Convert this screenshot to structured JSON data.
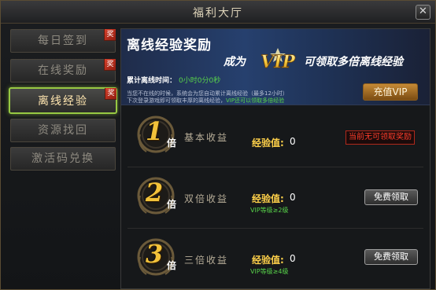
{
  "window": {
    "title": "福利大厅",
    "close_glyph": "✕"
  },
  "sidebar": {
    "items": [
      {
        "label": "每日签到",
        "badge": "奖",
        "active": false
      },
      {
        "label": "在线奖励",
        "badge": "奖",
        "active": false
      },
      {
        "label": "离线经验",
        "badge": "奖",
        "active": true
      },
      {
        "label": "资源找回",
        "badge": "",
        "active": false
      },
      {
        "label": "激活码兑换",
        "badge": "",
        "active": false
      }
    ]
  },
  "banner": {
    "title": "离线经验奖励",
    "vip_prefix": "成为",
    "vip_logo": "VIP",
    "vip_suffix": "可领取多倍离线经验",
    "offline_label": "累计离线时间：",
    "offline_value": "0小时0分0秒",
    "note1_a": "当您不在线的时候，系统会为您自动累计离线经验（最多12小时）",
    "note2_a": "下次登录游戏即可领取丰厚的离线经验，",
    "note2_b": "VIP还可以领取多倍经验",
    "recharge_label": "充值VIP"
  },
  "rewards": [
    {
      "multiplier": "1",
      "unit": "倍",
      "name": "基本收益",
      "exp_label": "经验值:",
      "exp_value": "0",
      "requirement": "",
      "status": "当前无可领取奖励",
      "button": ""
    },
    {
      "multiplier": "2",
      "unit": "倍",
      "name": "双倍收益",
      "exp_label": "经验值:",
      "exp_value": "0",
      "requirement": "VIP等级≥2级",
      "status": "",
      "button": "免费领取"
    },
    {
      "multiplier": "3",
      "unit": "倍",
      "name": "三倍收益",
      "exp_label": "经验值:",
      "exp_value": "0",
      "requirement": "VIP等级≥4级",
      "status": "",
      "button": "免费领取"
    }
  ],
  "colors": {
    "accent_gold": "#f2c23a",
    "active_tab_border": "#97c943",
    "green_text": "#58d44a",
    "red_text": "#ff3c2a"
  }
}
